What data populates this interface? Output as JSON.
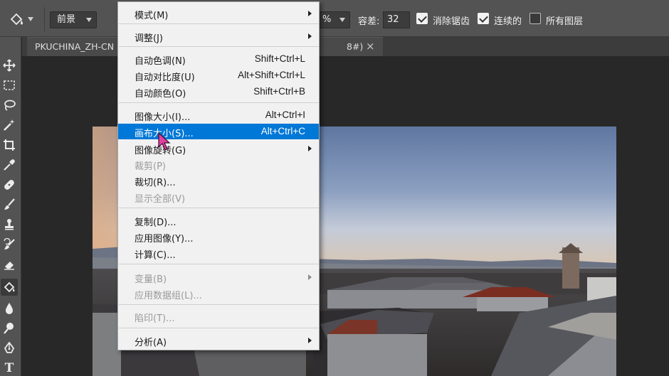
{
  "options_bar": {
    "fill_source": "前景",
    "opacity_suffix": "%",
    "tolerance_label": "容差:",
    "tolerance_value": "32",
    "antialias_label": "消除锯齿",
    "antialias_checked": true,
    "contiguous_label": "连续的",
    "contiguous_checked": true,
    "all_layers_label": "所有图层",
    "all_layers_checked": false
  },
  "document_tab": {
    "title": "PKUCHINA_ZH-CN",
    "suffix": "8#)",
    "close": "×"
  },
  "toolbar": {
    "tools": [
      "move-tool",
      "marquee-tool",
      "lasso-tool",
      "magic-wand-tool",
      "crop-tool",
      "eyedropper-tool",
      "healing-brush-tool",
      "brush-tool",
      "clone-stamp-tool",
      "history-brush-tool",
      "eraser-tool",
      "paint-bucket-tool",
      "blur-tool",
      "dodge-tool",
      "pen-tool",
      "type-tool"
    ],
    "active": "paint-bucket-tool",
    "type_glyph": "T"
  },
  "image_menu": {
    "items": [
      {
        "label": "模式(M)",
        "shortcut": "",
        "submenu": true,
        "disabled": false
      },
      {
        "label": "调整(J)",
        "shortcut": "",
        "submenu": true,
        "disabled": false
      },
      {
        "label": "自动色调(N)",
        "shortcut": "Shift+Ctrl+L",
        "submenu": false,
        "disabled": false
      },
      {
        "label": "自动对比度(U)",
        "shortcut": "Alt+Shift+Ctrl+L",
        "submenu": false,
        "disabled": false
      },
      {
        "label": "自动颜色(O)",
        "shortcut": "Shift+Ctrl+B",
        "submenu": false,
        "disabled": false
      },
      {
        "label": "图像大小(I)...",
        "shortcut": "Alt+Ctrl+I",
        "submenu": false,
        "disabled": false
      },
      {
        "label": "画布大小(S)...",
        "shortcut": "Alt+Ctrl+C",
        "submenu": false,
        "disabled": false,
        "highlighted": true
      },
      {
        "label": "图像旋转(G)",
        "shortcut": "",
        "submenu": true,
        "disabled": false
      },
      {
        "label": "裁剪(P)",
        "shortcut": "",
        "submenu": false,
        "disabled": true
      },
      {
        "label": "裁切(R)...",
        "shortcut": "",
        "submenu": false,
        "disabled": false
      },
      {
        "label": "显示全部(V)",
        "shortcut": "",
        "submenu": false,
        "disabled": true
      },
      {
        "label": "复制(D)...",
        "shortcut": "",
        "submenu": false,
        "disabled": false
      },
      {
        "label": "应用图像(Y)...",
        "shortcut": "",
        "submenu": false,
        "disabled": false
      },
      {
        "label": "计算(C)...",
        "shortcut": "",
        "submenu": false,
        "disabled": false
      },
      {
        "label": "变量(B)",
        "shortcut": "",
        "submenu": true,
        "disabled": true
      },
      {
        "label": "应用数据组(L)...",
        "shortcut": "",
        "submenu": false,
        "disabled": true
      },
      {
        "label": "陷印(T)...",
        "shortcut": "",
        "submenu": false,
        "disabled": true
      },
      {
        "label": "分析(A)",
        "shortcut": "",
        "submenu": true,
        "disabled": false
      }
    ]
  },
  "colors": {
    "highlight": "#0078d7",
    "spotlight": "#ffee00",
    "cursor": "#e040a0"
  }
}
